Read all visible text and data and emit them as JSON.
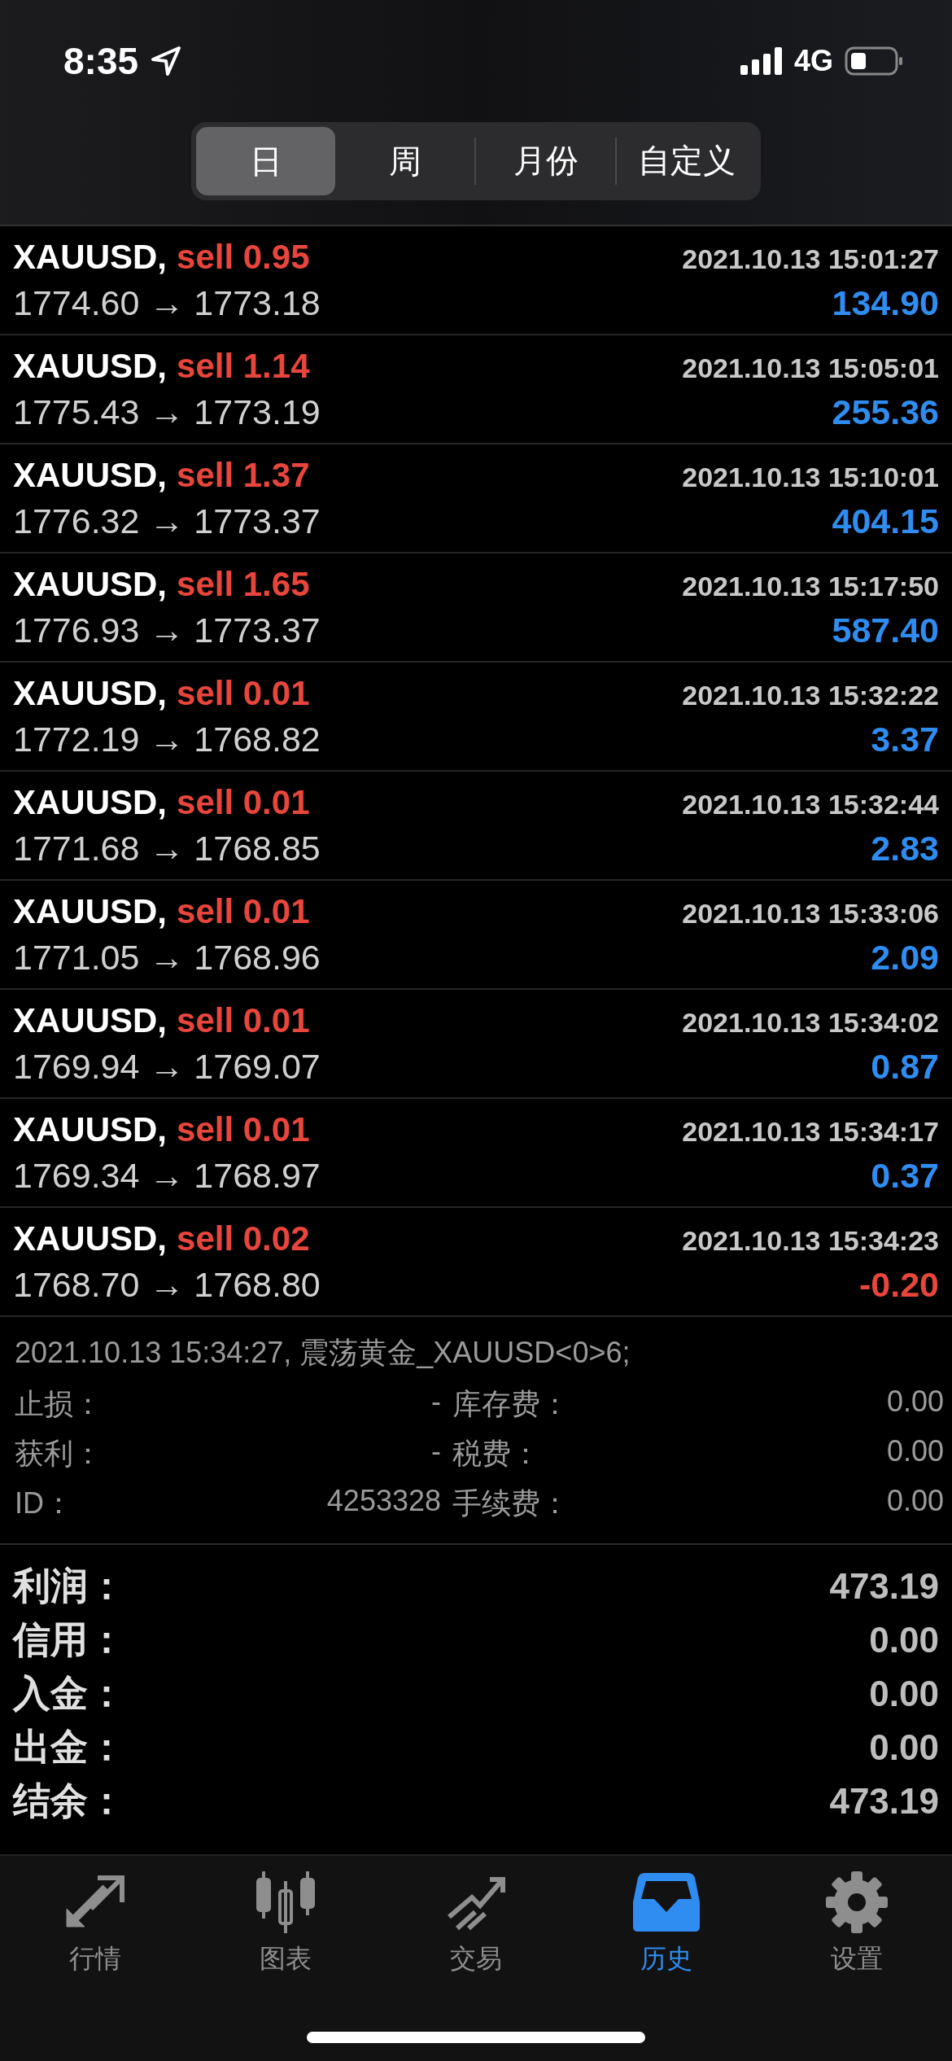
{
  "status_bar": {
    "time": "8:35",
    "network": "4G"
  },
  "tabs": [
    {
      "label": "日",
      "selected": true
    },
    {
      "label": "周",
      "selected": false
    },
    {
      "label": "月份",
      "selected": false
    },
    {
      "label": "自定义",
      "selected": false
    }
  ],
  "trades": [
    {
      "symbol": "XAUUSD,",
      "side": "sell 0.95",
      "time": "2021.10.13 15:01:27",
      "prices": "1774.60 → 1773.18",
      "profit": "134.90",
      "color": "#2f8cf0"
    },
    {
      "symbol": "XAUUSD,",
      "side": "sell 1.14",
      "time": "2021.10.13 15:05:01",
      "prices": "1775.43 → 1773.19",
      "profit": "255.36",
      "color": "#2f8cf0"
    },
    {
      "symbol": "XAUUSD,",
      "side": "sell 1.37",
      "time": "2021.10.13 15:10:01",
      "prices": "1776.32 → 1773.37",
      "profit": "404.15",
      "color": "#2f8cf0"
    },
    {
      "symbol": "XAUUSD,",
      "side": "sell 1.65",
      "time": "2021.10.13 15:17:50",
      "prices": "1776.93 → 1773.37",
      "profit": "587.40",
      "color": "#2f8cf0"
    },
    {
      "symbol": "XAUUSD,",
      "side": "sell 0.01",
      "time": "2021.10.13 15:32:22",
      "prices": "1772.19 → 1768.82",
      "profit": "3.37",
      "color": "#2f8cf0"
    },
    {
      "symbol": "XAUUSD,",
      "side": "sell 0.01",
      "time": "2021.10.13 15:32:44",
      "prices": "1771.68 → 1768.85",
      "profit": "2.83",
      "color": "#2f8cf0"
    },
    {
      "symbol": "XAUUSD,",
      "side": "sell 0.01",
      "time": "2021.10.13 15:33:06",
      "prices": "1771.05 → 1768.96",
      "profit": "2.09",
      "color": "#2f8cf0"
    },
    {
      "symbol": "XAUUSD,",
      "side": "sell 0.01",
      "time": "2021.10.13 15:34:02",
      "prices": "1769.94 → 1769.07",
      "profit": "0.87",
      "color": "#2f8cf0"
    },
    {
      "symbol": "XAUUSD,",
      "side": "sell 0.01",
      "time": "2021.10.13 15:34:17",
      "prices": "1769.34 → 1768.97",
      "profit": "0.37",
      "color": "#2f8cf0"
    },
    {
      "symbol": "XAUUSD,",
      "side": "sell 0.02",
      "time": "2021.10.13 15:34:23",
      "prices": "1768.70 → 1768.80",
      "profit": "-0.20",
      "color": "#e8453c"
    }
  ],
  "details": {
    "header": "2021.10.13 15:34:27, 震荡黄金_XAUUSD<0>6;",
    "rows": [
      {
        "left_label": "止损：",
        "left_value": "-",
        "right_label": "库存费：",
        "right_value": "0.00"
      },
      {
        "left_label": "获利：",
        "left_value": "-",
        "right_label": "税费：",
        "right_value": "0.00"
      },
      {
        "left_label": "ID：",
        "left_value": "4253328",
        "right_label": "手续费：",
        "right_value": "0.00"
      }
    ]
  },
  "summary": [
    {
      "label": "利润：",
      "value": "473.19"
    },
    {
      "label": "信用：",
      "value": "0.00"
    },
    {
      "label": "入金：",
      "value": "0.00"
    },
    {
      "label": "出金：",
      "value": "0.00"
    },
    {
      "label": "结余：",
      "value": "473.19"
    }
  ],
  "nav": [
    {
      "kind": "quotes",
      "label": "行情",
      "selected": false
    },
    {
      "kind": "chart",
      "label": "图表",
      "selected": false
    },
    {
      "kind": "trade",
      "label": "交易",
      "selected": false
    },
    {
      "kind": "history",
      "label": "历史",
      "selected": true
    },
    {
      "kind": "settings",
      "label": "设置",
      "selected": false
    }
  ]
}
